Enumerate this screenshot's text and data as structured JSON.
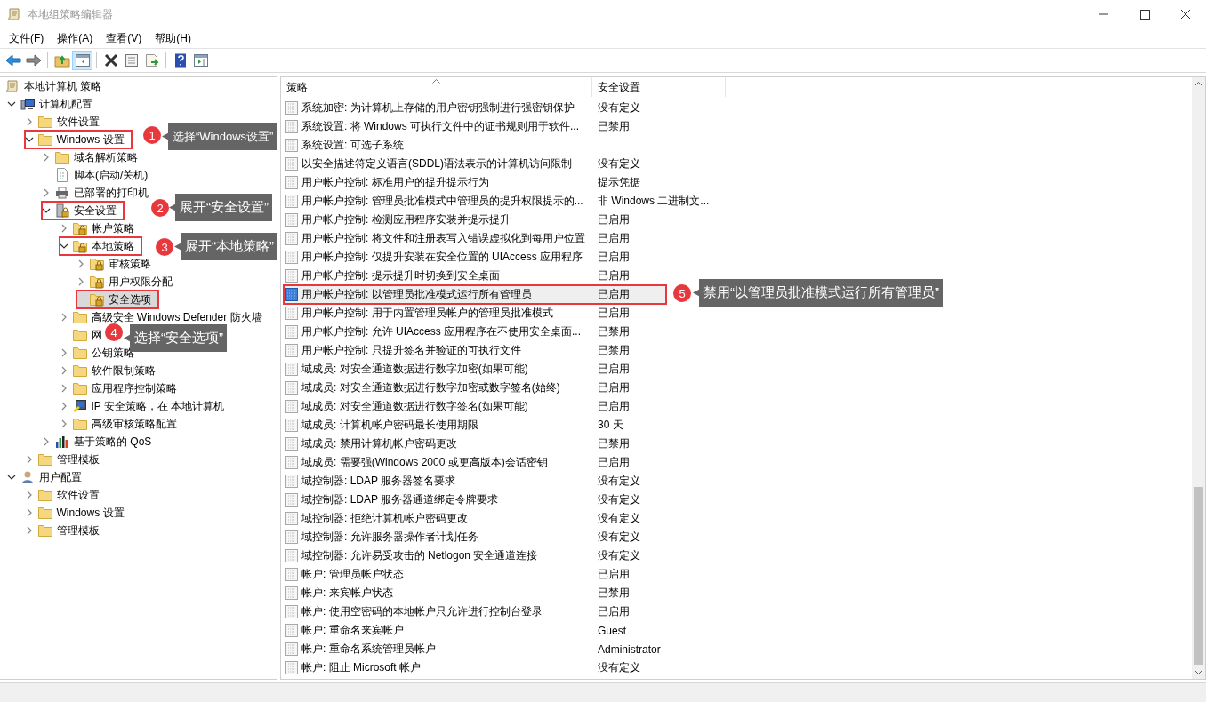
{
  "window": {
    "title": "本地组策略编辑器"
  },
  "menu": [
    "文件(F)",
    "操作(A)",
    "查看(V)",
    "帮助(H)"
  ],
  "tree": [
    {
      "label": "本地计算机 策略",
      "kind": "policy",
      "selected": false,
      "highlighted": false,
      "children": [
        {
          "label": "计算机配置",
          "kind": "computer",
          "expanded": true,
          "selected": false,
          "highlighted": false,
          "children": [
            {
              "label": "软件设置",
              "kind": "folder",
              "expanded": false,
              "selected": false,
              "highlighted": false
            },
            {
              "label": "Windows 设置",
              "kind": "folder",
              "expanded": true,
              "selected": false,
              "highlighted": true,
              "children": [
                {
                  "label": "域名解析策略",
                  "kind": "folder",
                  "expanded": false,
                  "selected": false,
                  "highlighted": false
                },
                {
                  "label": "脚本(启动/关机)",
                  "kind": "script",
                  "selected": false,
                  "highlighted": false
                },
                {
                  "label": "已部署的打印机",
                  "kind": "printer",
                  "expanded": false,
                  "selected": false,
                  "highlighted": false
                },
                {
                  "label": "安全设置",
                  "kind": "security",
                  "expanded": true,
                  "selected": false,
                  "highlighted": true,
                  "children": [
                    {
                      "label": "帐户策略",
                      "kind": "locked-folder",
                      "expanded": false,
                      "selected": false,
                      "highlighted": false
                    },
                    {
                      "label": "本地策略",
                      "kind": "locked-folder",
                      "expanded": true,
                      "selected": false,
                      "highlighted": true,
                      "children": [
                        {
                          "label": "审核策略",
                          "kind": "locked-folder",
                          "expanded": false,
                          "selected": false,
                          "highlighted": false
                        },
                        {
                          "label": "用户权限分配",
                          "kind": "locked-folder",
                          "expanded": false,
                          "selected": false,
                          "highlighted": false
                        },
                        {
                          "label": "安全选项",
                          "kind": "locked-folder",
                          "selected": true,
                          "highlighted": true
                        }
                      ]
                    },
                    {
                      "label": "高级安全 Windows Defender 防火墙",
                      "kind": "folder",
                      "expanded": false,
                      "selected": false,
                      "highlighted": false
                    },
                    {
                      "label": "网",
                      "kind": "folder",
                      "selected": false,
                      "highlighted": false
                    },
                    {
                      "label": "公钥策略",
                      "kind": "folder",
                      "expanded": false,
                      "selected": false,
                      "highlighted": false
                    },
                    {
                      "label": "软件限制策略",
                      "kind": "folder",
                      "expanded": false,
                      "selected": false,
                      "highlighted": false
                    },
                    {
                      "label": "应用程序控制策略",
                      "kind": "folder",
                      "expanded": false,
                      "selected": false,
                      "highlighted": false
                    },
                    {
                      "label": "IP 安全策略，在 本地计算机",
                      "kind": "ip",
                      "expanded": false,
                      "selected": false,
                      "highlighted": false
                    },
                    {
                      "label": "高级审核策略配置",
                      "kind": "folder",
                      "expanded": false,
                      "selected": false,
                      "highlighted": false
                    }
                  ]
                },
                {
                  "label": "基于策略的 QoS",
                  "kind": "chart",
                  "expanded": false,
                  "selected": false,
                  "highlighted": false
                }
              ]
            },
            {
              "label": "管理模板",
              "kind": "folder",
              "expanded": false,
              "selected": false,
              "highlighted": false
            }
          ]
        },
        {
          "label": "用户配置",
          "kind": "user",
          "expanded": true,
          "selected": false,
          "highlighted": false,
          "children": [
            {
              "label": "软件设置",
              "kind": "folder",
              "expanded": false,
              "selected": false,
              "highlighted": false
            },
            {
              "label": "Windows 设置",
              "kind": "folder",
              "expanded": false,
              "selected": false,
              "highlighted": false
            },
            {
              "label": "管理模板",
              "kind": "folder",
              "expanded": false,
              "selected": false,
              "highlighted": false
            }
          ]
        }
      ]
    }
  ],
  "table": {
    "columns": [
      "策略",
      "安全设置"
    ],
    "rows": [
      {
        "policy": "系统加密: 为计算机上存储的用户密钥强制进行强密钥保护",
        "setting": "没有定义",
        "selected": false,
        "highlighted": false
      },
      {
        "policy": "系统设置: 将 Windows 可执行文件中的证书规则用于软件...",
        "setting": "已禁用",
        "selected": false,
        "highlighted": false
      },
      {
        "policy": "系统设置: 可选子系统",
        "selected": false,
        "highlighted": false
      },
      {
        "policy": "以安全描述符定义语言(SDDL)语法表示的计算机访问限制",
        "setting": "没有定义",
        "selected": false,
        "highlighted": false
      },
      {
        "policy": "用户帐户控制: 标准用户的提升提示行为",
        "setting": "提示凭据",
        "selected": false,
        "highlighted": false
      },
      {
        "policy": "用户帐户控制: 管理员批准模式中管理员的提升权限提示的...",
        "setting": "非 Windows 二进制文...",
        "selected": false,
        "highlighted": false
      },
      {
        "policy": "用户帐户控制: 检测应用程序安装并提示提升",
        "setting": "已启用",
        "selected": false,
        "highlighted": false
      },
      {
        "policy": "用户帐户控制: 将文件和注册表写入错误虚拟化到每用户位置",
        "setting": "已启用",
        "selected": false,
        "highlighted": false
      },
      {
        "policy": "用户帐户控制: 仅提升安装在安全位置的 UIAccess 应用程序",
        "setting": "已启用",
        "selected": false,
        "highlighted": false
      },
      {
        "policy": "用户帐户控制: 提示提升时切换到安全桌面",
        "setting": "已启用",
        "selected": false,
        "highlighted": false
      },
      {
        "policy": "用户帐户控制: 以管理员批准模式运行所有管理员",
        "setting": "已启用",
        "selected": true,
        "highlighted": true
      },
      {
        "policy": "用户帐户控制: 用于内置管理员帐户的管理员批准模式",
        "setting": "已启用",
        "selected": false,
        "highlighted": false
      },
      {
        "policy": "用户帐户控制: 允许 UIAccess 应用程序在不使用安全桌面...",
        "setting": "已禁用",
        "selected": false,
        "highlighted": false
      },
      {
        "policy": "用户帐户控制: 只提升签名并验证的可执行文件",
        "setting": "已禁用",
        "selected": false,
        "highlighted": false
      },
      {
        "policy": "域成员: 对安全通道数据进行数字加密(如果可能)",
        "setting": "已启用",
        "selected": false,
        "highlighted": false
      },
      {
        "policy": "域成员: 对安全通道数据进行数字加密或数字签名(始终)",
        "setting": "已启用",
        "selected": false,
        "highlighted": false
      },
      {
        "policy": "域成员: 对安全通道数据进行数字签名(如果可能)",
        "setting": "已启用",
        "selected": false,
        "highlighted": false
      },
      {
        "policy": "域成员: 计算机帐户密码最长使用期限",
        "setting": "30 天",
        "selected": false,
        "highlighted": false
      },
      {
        "policy": "域成员: 禁用计算机帐户密码更改",
        "setting": "已禁用",
        "selected": false,
        "highlighted": false
      },
      {
        "policy": "域成员: 需要强(Windows 2000 或更高版本)会话密钥",
        "setting": "已启用",
        "selected": false,
        "highlighted": false
      },
      {
        "policy": "域控制器: LDAP 服务器签名要求",
        "setting": "没有定义",
        "selected": false,
        "highlighted": false
      },
      {
        "policy": "域控制器: LDAP 服务器通道绑定令牌要求",
        "setting": "没有定义",
        "selected": false,
        "highlighted": false
      },
      {
        "policy": "域控制器: 拒绝计算机帐户密码更改",
        "setting": "没有定义",
        "selected": false,
        "highlighted": false
      },
      {
        "policy": "域控制器: 允许服务器操作者计划任务",
        "setting": "没有定义",
        "selected": false,
        "highlighted": false
      },
      {
        "policy": "域控制器:  允许易受攻击的 Netlogon 安全通道连接",
        "setting": "没有定义",
        "selected": false,
        "highlighted": false
      },
      {
        "policy": "帐户: 管理员帐户状态",
        "setting": "已启用",
        "selected": false,
        "highlighted": false
      },
      {
        "policy": "帐户: 来宾帐户状态",
        "setting": "已禁用",
        "selected": false,
        "highlighted": false
      },
      {
        "policy": "帐户: 使用空密码的本地帐户只允许进行控制台登录",
        "setting": "已启用",
        "selected": false,
        "highlighted": false
      },
      {
        "policy": "帐户: 重命名来宾帐户",
        "setting": "Guest",
        "selected": false,
        "highlighted": false
      },
      {
        "policy": "帐户: 重命名系统管理员帐户",
        "setting": "Administrator",
        "selected": false,
        "highlighted": false
      },
      {
        "policy": "帐户: 阻止 Microsoft 帐户",
        "setting": "没有定义",
        "selected": false,
        "highlighted": false
      }
    ]
  },
  "annotations": [
    {
      "number": "1",
      "text": "选择“Windows设置”"
    },
    {
      "number": "2",
      "text": "展开“安全设置”"
    },
    {
      "number": "3",
      "text": "展开“本地策略”"
    },
    {
      "number": "4",
      "text": "选择“安全选项”"
    },
    {
      "number": "5",
      "text": "禁用“以管理员批准模式运行所有管理员”"
    }
  ]
}
